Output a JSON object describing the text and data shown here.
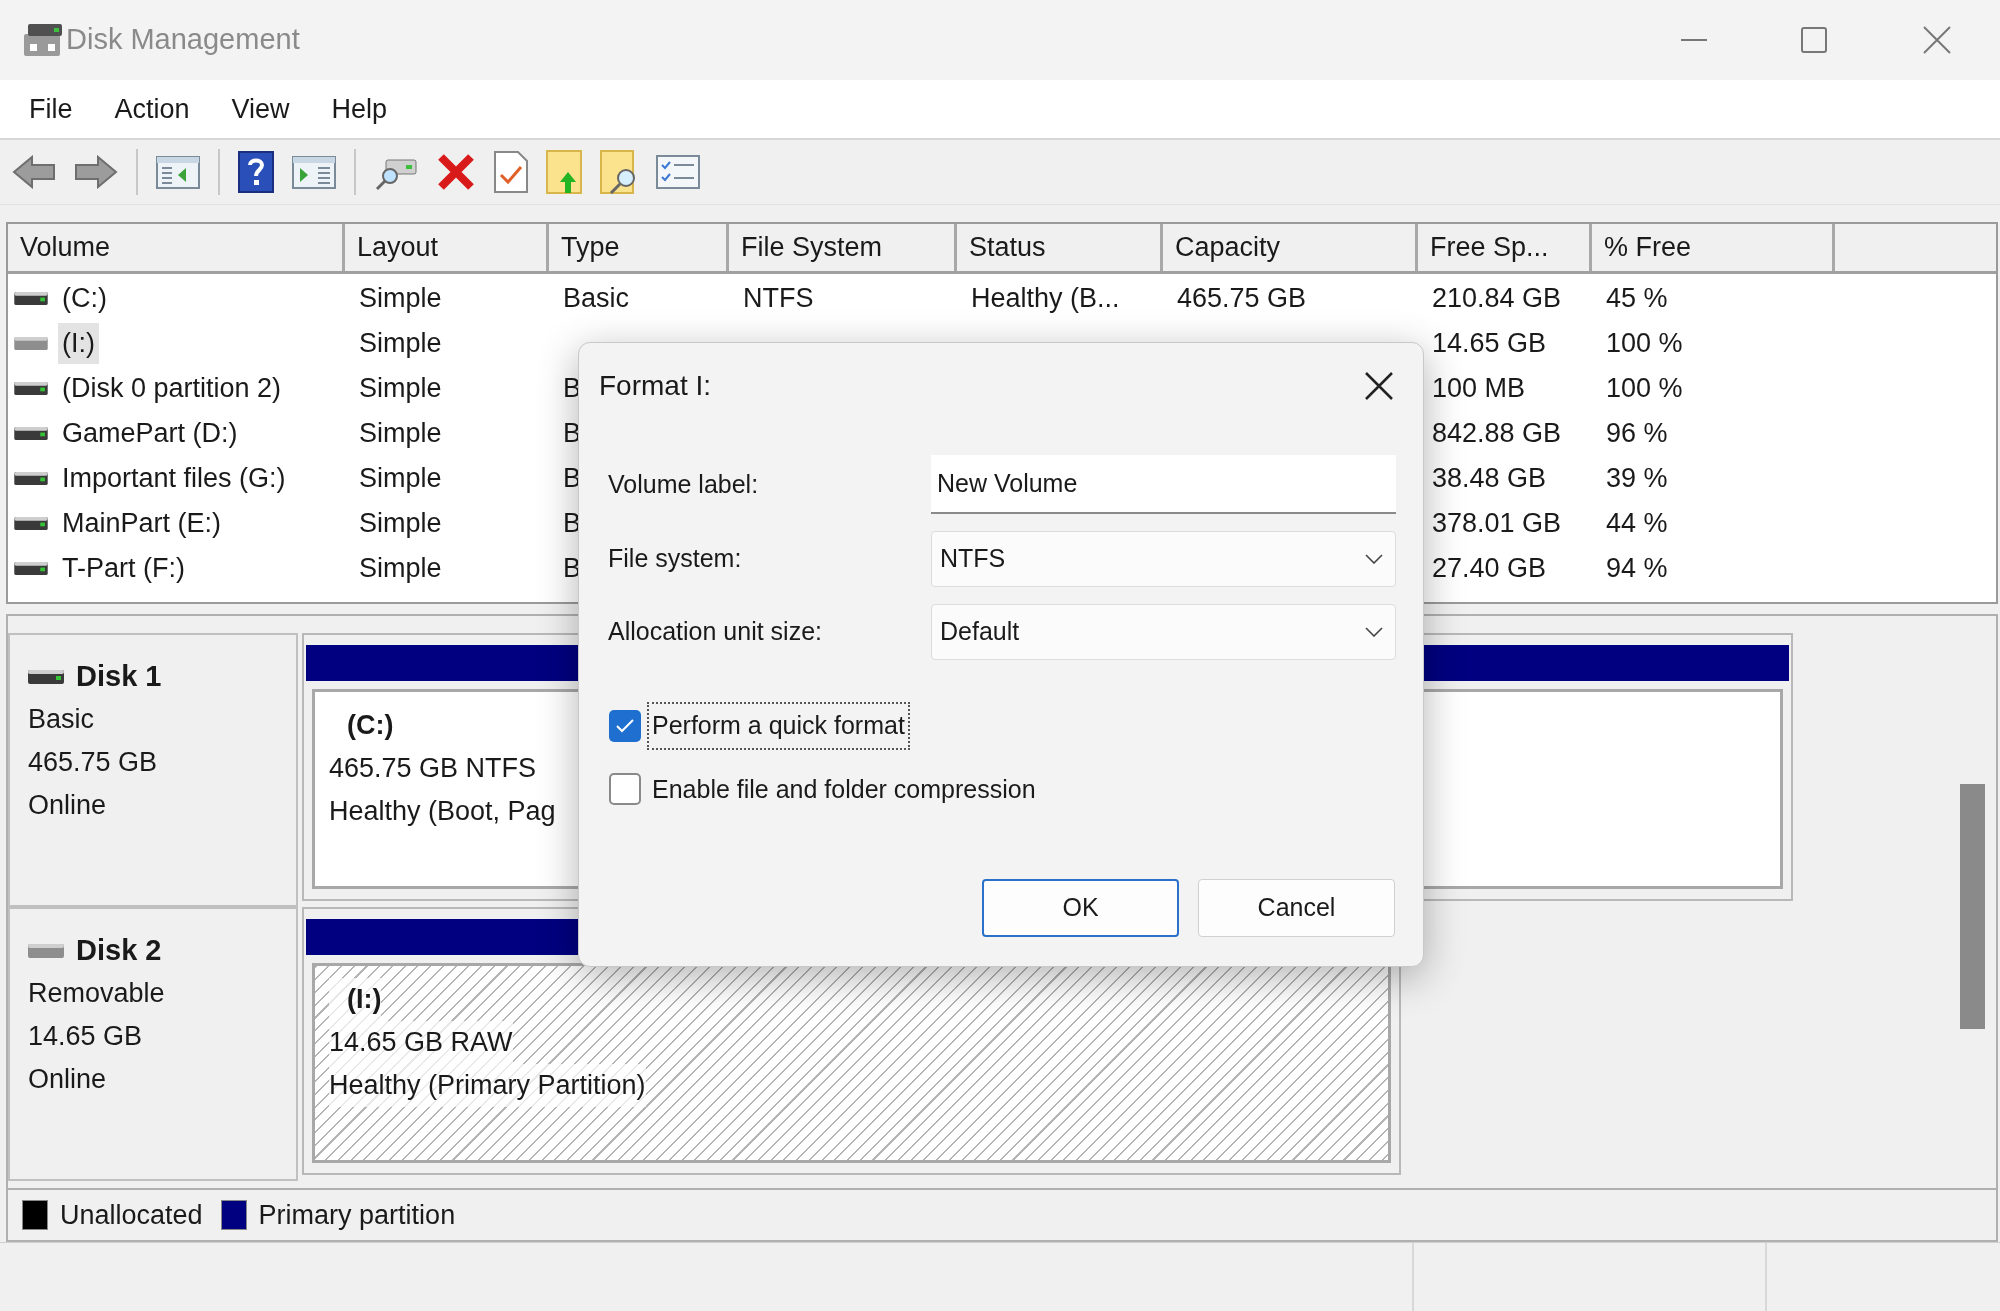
{
  "window": {
    "title": "Disk Management"
  },
  "menu": [
    "File",
    "Action",
    "View",
    "Help"
  ],
  "volume_list": {
    "columns": [
      "Volume",
      "Layout",
      "Type",
      "File System",
      "Status",
      "Capacity",
      "Free Sp...",
      "% Free"
    ],
    "rows": [
      {
        "volume": "(C:)",
        "layout": "Simple",
        "type": "Basic",
        "file_system": "NTFS",
        "status": "Healthy (B...",
        "capacity": "465.75 GB",
        "free_space": "210.84 GB",
        "percent_free": "45 %",
        "selected": false,
        "removable": false
      },
      {
        "volume": "(I:)",
        "layout": "Simple",
        "free_space": "14.65 GB",
        "percent_free": "100 %",
        "selected": true,
        "removable": true
      },
      {
        "volume": "(Disk 0 partition 2)",
        "layout": "Simple",
        "type": "B",
        "free_space": "100 MB",
        "percent_free": "100 %",
        "selected": false,
        "removable": false
      },
      {
        "volume": "GamePart (D:)",
        "layout": "Simple",
        "type": "B",
        "free_space": "842.88 GB",
        "percent_free": "96 %",
        "selected": false,
        "removable": false
      },
      {
        "volume": "Important files (G:)",
        "layout": "Simple",
        "type": "B",
        "free_space": "38.48 GB",
        "percent_free": "39 %",
        "selected": false,
        "removable": false
      },
      {
        "volume": "MainPart (E:)",
        "layout": "Simple",
        "type": "B",
        "free_space": "378.01 GB",
        "percent_free": "44 %",
        "selected": false,
        "removable": false
      },
      {
        "volume": "T-Part (F:)",
        "layout": "Simple",
        "type": "B",
        "free_space": "27.40 GB",
        "percent_free": "94 %",
        "selected": false,
        "removable": false
      }
    ]
  },
  "disks": [
    {
      "name": "Disk 1",
      "type": "Basic",
      "size": "465.75 GB",
      "status": "Online",
      "removable": false,
      "partitions": [
        {
          "name": "(C:)",
          "size_fs": "465.75 GB NTFS",
          "status": "Healthy (Boot, Pag",
          "kind": "primary"
        }
      ]
    },
    {
      "name": "Disk 2",
      "type": "Removable",
      "size": "14.65 GB",
      "status": "Online",
      "removable": true,
      "partitions": [
        {
          "name": "(I:)",
          "size_fs": "14.65 GB RAW",
          "status": "Healthy (Primary Partition)",
          "kind": "raw"
        }
      ]
    }
  ],
  "legend": [
    {
      "label": "Unallocated",
      "color": "#000000"
    },
    {
      "label": "Primary partition",
      "color": "#000080"
    }
  ],
  "dialog": {
    "title": "Format I:",
    "fields": [
      {
        "label": "Volume label:",
        "kind": "text",
        "value": "New Volume"
      },
      {
        "label": "File system:",
        "kind": "dropdown",
        "value": "NTFS"
      },
      {
        "label": "Allocation unit size:",
        "kind": "dropdown",
        "value": "Default"
      }
    ],
    "options": [
      {
        "label": "Perform a quick format",
        "checked": true,
        "focused": true
      },
      {
        "label": "Enable file and folder compression",
        "checked": false,
        "focused": false
      }
    ],
    "buttons": [
      {
        "label": "OK",
        "default": true
      },
      {
        "label": "Cancel",
        "default": false
      }
    ]
  }
}
